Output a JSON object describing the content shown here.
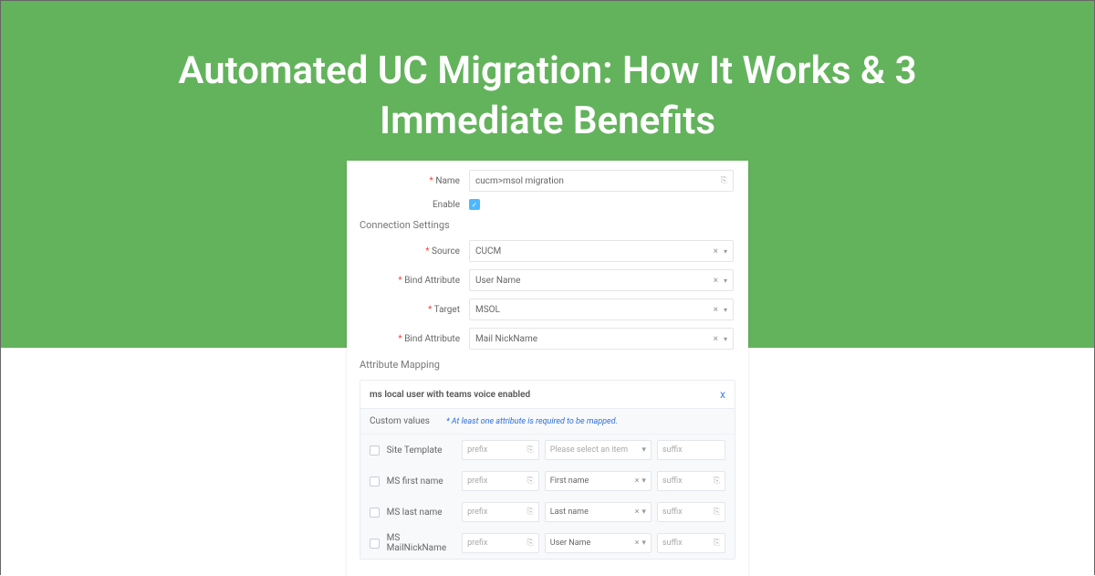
{
  "hero": {
    "title": "Automated UC Migration: How It Works & 3 Immediate Benefits"
  },
  "form": {
    "name_label": "Name",
    "name_value": "cucm>msol migration",
    "enable_label": "Enable",
    "connection_title": "Connection Settings",
    "source_label": "Source",
    "source_value": "CUCM",
    "bind_attr_label": "Bind Attribute",
    "bind_attr1_value": "User Name",
    "target_label": "Target",
    "target_value": "MSOL",
    "bind_attr2_value": "Mail NickName",
    "mapping_title": "Attribute Mapping",
    "map_header": "ms local user with teams voice enabled",
    "custom_values_label": "Custom values",
    "custom_note": "* At least one attribute is required to be mapped.",
    "placeholders": {
      "prefix": "prefix",
      "suffix": "suffix",
      "select_item": "Please select an item"
    },
    "rows": [
      {
        "label": "Site Template",
        "middle": "Please select an item",
        "clear": false,
        "suffix_copy": false
      },
      {
        "label": "MS first name",
        "middle": "First name",
        "clear": true,
        "suffix_copy": true
      },
      {
        "label": "MS last name",
        "middle": "Last name",
        "clear": true,
        "suffix_copy": true
      },
      {
        "label": "MS MailNickName",
        "middle": "User Name",
        "clear": true,
        "suffix_copy": true
      }
    ]
  }
}
